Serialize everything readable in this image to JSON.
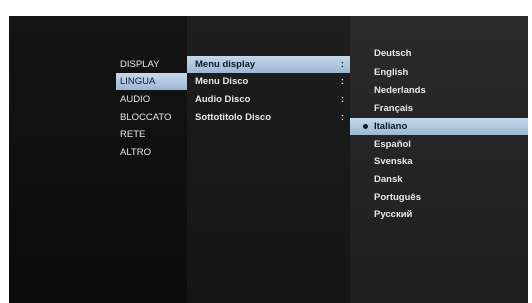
{
  "categories": [
    {
      "label": "DISPLAY",
      "selected": false
    },
    {
      "label": "LINGUA",
      "selected": true
    },
    {
      "label": "AUDIO",
      "selected": false
    },
    {
      "label": "BLOCCATO",
      "selected": false
    },
    {
      "label": "RETE",
      "selected": false
    },
    {
      "label": "ALTRO",
      "selected": false
    }
  ],
  "options": [
    {
      "label": "Menu display",
      "colon": ":",
      "selected": true
    },
    {
      "label": "Menu Disco",
      "colon": ":",
      "selected": false
    },
    {
      "label": "Audio Disco",
      "colon": ":",
      "selected": false
    },
    {
      "label": "Sottotitolo Disco",
      "colon": ":",
      "selected": false
    }
  ],
  "languages": [
    {
      "label": "Deutsch",
      "selected": false
    },
    {
      "label": "English",
      "selected": false
    },
    {
      "label": "Nederlands",
      "selected": false
    },
    {
      "label": "Français",
      "selected": false
    },
    {
      "label": "Italiano",
      "selected": true
    },
    {
      "label": "Español",
      "selected": false
    },
    {
      "label": "Svenska",
      "selected": false
    },
    {
      "label": "Dansk",
      "selected": false
    },
    {
      "label": "Português",
      "selected": false
    },
    {
      "label": "Русский",
      "selected": false
    }
  ],
  "colors": {
    "highlight": "#b4cbe2",
    "background": "#0d0d0d"
  }
}
